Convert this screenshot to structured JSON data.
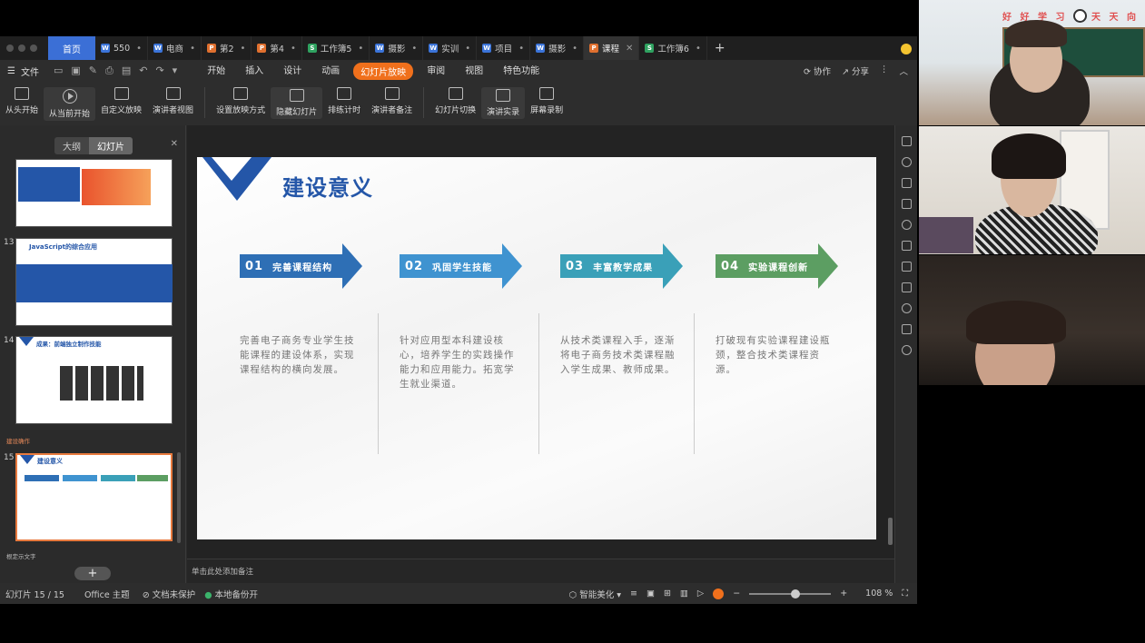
{
  "tabs": {
    "home": "首页",
    "docs": [
      {
        "label": "550",
        "type": "w"
      },
      {
        "label": "电商",
        "type": "w"
      },
      {
        "label": "第2",
        "type": "p"
      },
      {
        "label": "第4",
        "type": "p"
      },
      {
        "label": "工作簿5",
        "type": "s"
      },
      {
        "label": "摄影",
        "type": "w"
      },
      {
        "label": "实训",
        "type": "w"
      },
      {
        "label": "项目",
        "type": "w"
      },
      {
        "label": "摄影",
        "type": "w"
      },
      {
        "label": "课程",
        "type": "p",
        "active": true
      },
      {
        "label": "工作簿6",
        "type": "s"
      }
    ]
  },
  "menu": {
    "file": "文件",
    "items": [
      "开始",
      "插入",
      "设计",
      "动画",
      "幻灯片放映",
      "审阅",
      "视图",
      "特色功能"
    ],
    "active": "幻灯片放映",
    "collab": "协作",
    "share": "分享"
  },
  "ribbon": [
    "从头开始",
    "从当前开始",
    "自定义放映",
    "演讲者视图",
    "设置放映方式",
    "隐藏幻灯片",
    "排练计时",
    "演讲者备注",
    "幻灯片切换",
    "演讲实录",
    "屏幕录制"
  ],
  "left_panel": {
    "outline": "大纲",
    "slides": "幻灯片",
    "thumb13_title": "JavaScript的综合应用",
    "thumb14_title": "成果：前端独立制作技能",
    "thumb15_title": "建设意义",
    "section1": "建设确作",
    "section2": "根定示文字",
    "nums": [
      "13",
      "14",
      "15"
    ],
    "add": "+"
  },
  "slide": {
    "title": "建设意义",
    "items": [
      {
        "num": "01",
        "label": "完善课程结构",
        "text": "完善电子商务专业学生技能课程的建设体系，实现课程结构的横向发展。",
        "color": "#2e6fb5"
      },
      {
        "num": "02",
        "label": "巩固学生技能",
        "text": "针对应用型本科建设核心，培养学生的实践操作能力和应用能力。拓宽学生就业渠道。",
        "color": "#3f93d0"
      },
      {
        "num": "03",
        "label": "丰富教学成果",
        "text": "从技术类课程入手，逐渐将电子商务技术类课程融入学生成果、教师成果。",
        "color": "#3aa0b8"
      },
      {
        "num": "04",
        "label": "实验课程创新",
        "text": "打破现有实验课程建设瓶颈，整合技术类课程资源。",
        "color": "#5c9e62"
      }
    ]
  },
  "notes_placeholder": "单击此处添加备注",
  "status": {
    "slide_count": "幻灯片 15 / 15",
    "theme": "Office 主题",
    "protect": "文档未保护",
    "backup": "本地备份开",
    "beautify": "智能美化",
    "zoom": "108 %"
  },
  "video": {
    "banner": "好 好 学 习",
    "banner2": "天 天 向"
  }
}
